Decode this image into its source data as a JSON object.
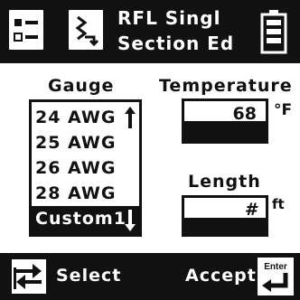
{
  "header": {
    "title_line1": "RFL Singl",
    "title_line2": "Section Ed",
    "icons": [
      "checklist-icon",
      "cable-icon",
      "battery-icon"
    ]
  },
  "gauge": {
    "label": "Gauge",
    "items": [
      "24 AWG",
      "25 AWG",
      "26 AWG",
      "28 AWG",
      "Custom1"
    ],
    "selected": "Custom1"
  },
  "temperature": {
    "label": "Temperature",
    "value": "68",
    "unit": "°F"
  },
  "length": {
    "label": "Length",
    "value": "#",
    "unit": "ft"
  },
  "footer": {
    "select_label": "Select",
    "accept_label": "Accept",
    "enter_icon_text": "Enter"
  }
}
